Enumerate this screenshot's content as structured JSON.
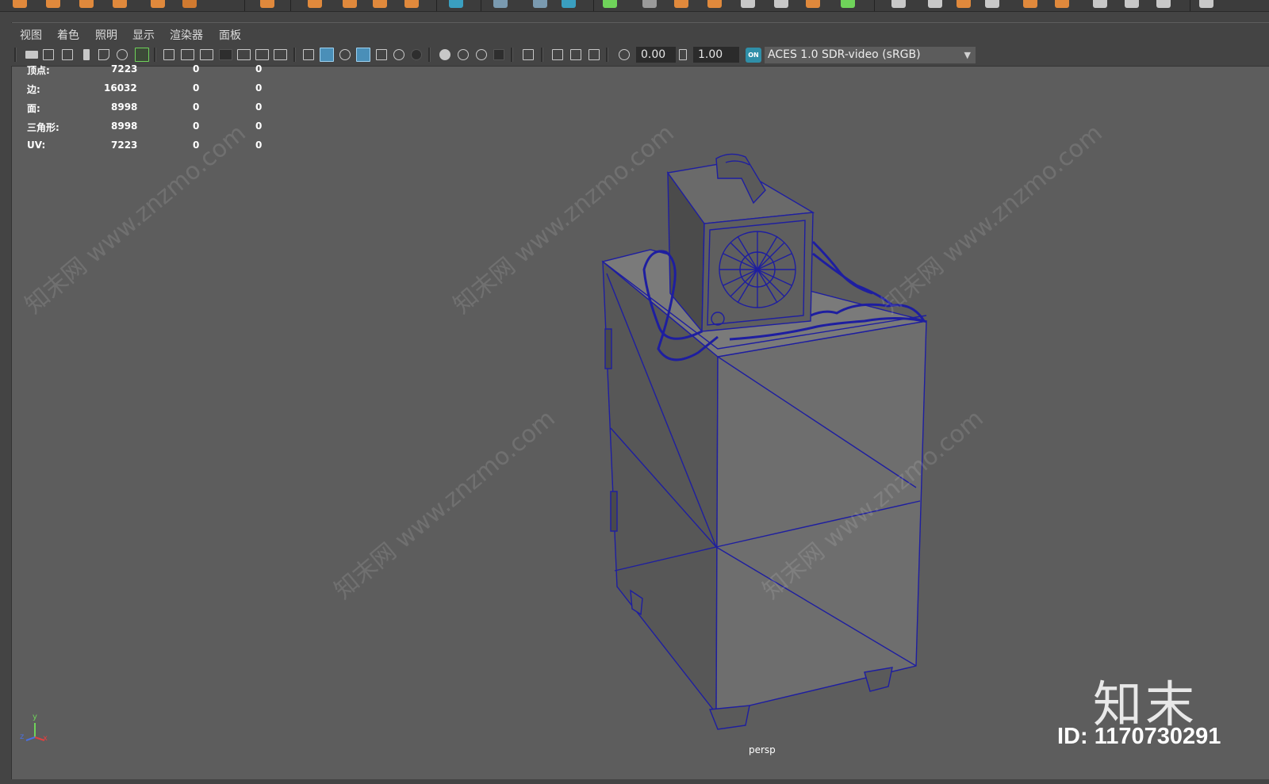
{
  "menu": {
    "view": "视图",
    "shading": "着色",
    "lighting": "照明",
    "show": "显示",
    "renderer": "渲染器",
    "panels": "面板"
  },
  "toolbar": {
    "exposure_value": "0.00",
    "gamma_value": "1.00",
    "color_space": "ACES 1.0 SDR-video (sRGB)",
    "color_management_badge": "ON"
  },
  "hud": {
    "rows": [
      {
        "label": "顶点:",
        "value": "7223",
        "selected": "0",
        "uv": "0"
      },
      {
        "label": "边:",
        "value": "16032",
        "selected": "0",
        "uv": "0"
      },
      {
        "label": "面:",
        "value": "8998",
        "selected": "0",
        "uv": "0"
      },
      {
        "label": "三角形:",
        "value": "8998",
        "selected": "0",
        "uv": "0"
      },
      {
        "label": "UV:",
        "value": "7223",
        "selected": "0",
        "uv": "0"
      }
    ]
  },
  "viewport": {
    "camera_label": "persp",
    "axis_labels": {
      "x": "x",
      "y": "y",
      "z": "z"
    }
  },
  "watermark": {
    "brand": "知末",
    "id_text": "ID: 1170730291",
    "diagonal_text": "知末网 www.znzmo.com"
  },
  "colors": {
    "viewport_bg": "#5d5d5d",
    "ui_bg": "#444444",
    "wireframe": "#1e1ea0",
    "accent": "#4a8fb8"
  }
}
